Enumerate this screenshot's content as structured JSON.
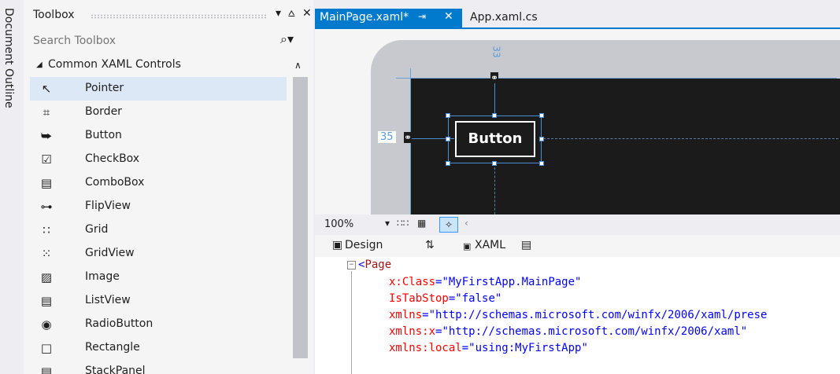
{
  "document_outline": {
    "label": "Document Outline"
  },
  "toolbox": {
    "title": "Toolbox",
    "pin_glyph": "⩟",
    "dropdown_glyph": "▾",
    "close_glyph": "✕",
    "search_placeholder": "Search Toolbox",
    "group": "Common XAML Controls",
    "items": [
      {
        "label": "Pointer",
        "icon": "pointer-icon",
        "glyph": "↖",
        "selected": true
      },
      {
        "label": "Border",
        "icon": "border-icon",
        "glyph": "⌗"
      },
      {
        "label": "Button",
        "icon": "button-icon",
        "glyph": "⮩"
      },
      {
        "label": "CheckBox",
        "icon": "checkbox-icon",
        "glyph": "☑"
      },
      {
        "label": "ComboBox",
        "icon": "combobox-icon",
        "glyph": "▤"
      },
      {
        "label": "FlipView",
        "icon": "flipview-icon",
        "glyph": "⊶"
      },
      {
        "label": "Grid",
        "icon": "grid-icon",
        "glyph": "∷"
      },
      {
        "label": "GridView",
        "icon": "gridview-icon",
        "glyph": "⁙"
      },
      {
        "label": "Image",
        "icon": "image-icon",
        "glyph": "▨"
      },
      {
        "label": "ListView",
        "icon": "listview-icon",
        "glyph": "▤"
      },
      {
        "label": "RadioButton",
        "icon": "radiobutton-icon",
        "glyph": "◉"
      },
      {
        "label": "Rectangle",
        "icon": "rectangle-icon",
        "glyph": "□"
      },
      {
        "label": "StackPanel",
        "icon": "stackpanel-icon",
        "glyph": "▤"
      }
    ]
  },
  "tabs": {
    "active": "MainPage.xaml*",
    "active_pin": "⇥",
    "active_close": "✕",
    "inactive": "App.xaml.cs"
  },
  "designer": {
    "top_margin": "33",
    "left_margin": "35",
    "button_text": "Button"
  },
  "zoom": {
    "value": "100%",
    "more": "‹"
  },
  "split": {
    "design": "Design",
    "swap": "⇅",
    "xaml": "XAML"
  },
  "code": {
    "lines": [
      {
        "tag": "Page"
      },
      {
        "attr": "x:Class",
        "val": "\"MyFirstApp.MainPage\""
      },
      {
        "attr": "IsTabStop",
        "val": "\"false\""
      },
      {
        "attr": "xmlns",
        "val": "\"http://schemas.microsoft.com/winfx/2006/xaml/prese"
      },
      {
        "attr": "xmlns:x",
        "val": "\"http://schemas.microsoft.com/winfx/2006/xaml\""
      },
      {
        "attr": "xmlns:local",
        "val": "\"using:MyFirstApp\""
      }
    ]
  },
  "colors": {
    "accent": "#007acc",
    "selection": "#dde8f6",
    "tag": "#a31515",
    "attr": "#ff0000",
    "value": "#0000ff"
  }
}
